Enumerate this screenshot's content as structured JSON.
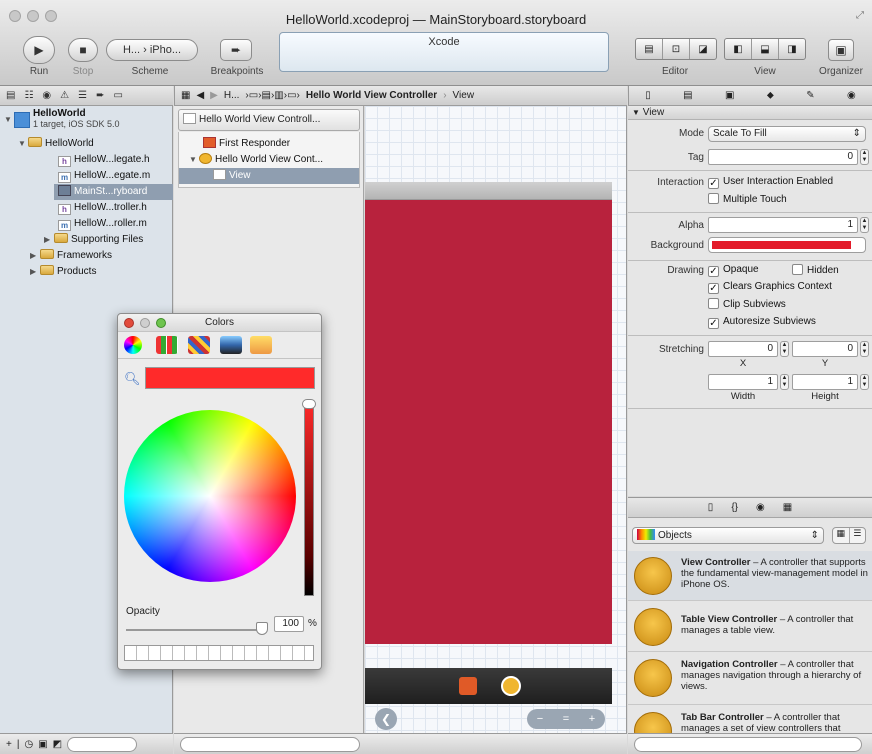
{
  "window": {
    "title": "HelloWorld.xcodeproj — MainStoryboard.storyboard"
  },
  "toolbar": {
    "run": "Run",
    "stop": "Stop",
    "scheme_label": "Scheme",
    "scheme_value": "H... › iPho...",
    "breakpoints": "Breakpoints",
    "activity_title": "Xcode",
    "editor": "Editor",
    "view": "View",
    "organizer": "Organizer"
  },
  "jumpbar": {
    "items": [
      "H...",
      "Hello World View Controller",
      "View"
    ]
  },
  "navigator": {
    "project": "HelloWorld",
    "project_sub": "1 target, iOS SDK 5.0",
    "group": "HelloWorld",
    "files": [
      "HelloW...legate.h",
      "HelloW...egate.m",
      "MainSt...ryboard",
      "HelloW...troller.h",
      "HelloW...roller.m"
    ],
    "file_badges": [
      "h",
      "m",
      "",
      "h",
      "m"
    ],
    "supporting": "Supporting Files",
    "frameworks": "Frameworks",
    "products": "Products"
  },
  "outline": {
    "header": "Hello World View Controll...",
    "first_responder": "First Responder",
    "controller": "Hello World View Cont...",
    "view": "View"
  },
  "inspector": {
    "section": "View",
    "mode_label": "Mode",
    "mode_value": "Scale To Fill",
    "tag_label": "Tag",
    "tag_value": "0",
    "interaction_label": "Interaction",
    "user_interaction": "User Interaction Enabled",
    "multiple_touch": "Multiple Touch",
    "alpha_label": "Alpha",
    "alpha_value": "1",
    "background_label": "Background",
    "background_color": "#e31b2a",
    "drawing_label": "Drawing",
    "opaque": "Opaque",
    "hidden": "Hidden",
    "clears": "Clears Graphics Context",
    "clip": "Clip Subviews",
    "autoresize": "Autoresize Subviews",
    "stretching_label": "Stretching",
    "x_value": "0",
    "y_value": "0",
    "width_value": "1",
    "height_value": "1",
    "x_label": "X",
    "y_label": "Y",
    "width_label": "Width",
    "height_label": "Height"
  },
  "library": {
    "selector": "Objects",
    "items": [
      {
        "title": "View Controller",
        "desc": " – A controller that supports the fundamental view-management model in iPhone OS."
      },
      {
        "title": "Table View Controller",
        "desc": " – A controller that manages a table view."
      },
      {
        "title": "Navigation Controller",
        "desc": " – A controller that manages navigation through a hierarchy of views."
      },
      {
        "title": "Tab Bar Controller",
        "desc": " – A controller that manages a set of view controllers that"
      }
    ]
  },
  "colors": {
    "title": "Colors",
    "opacity_label": "Opacity",
    "opacity_value": "100",
    "percent": "%",
    "swatch": "#ff2a2a"
  },
  "canvas": {
    "view_color": "#b8223d",
    "zoom_buttons": [
      "−",
      "=",
      "+"
    ]
  }
}
